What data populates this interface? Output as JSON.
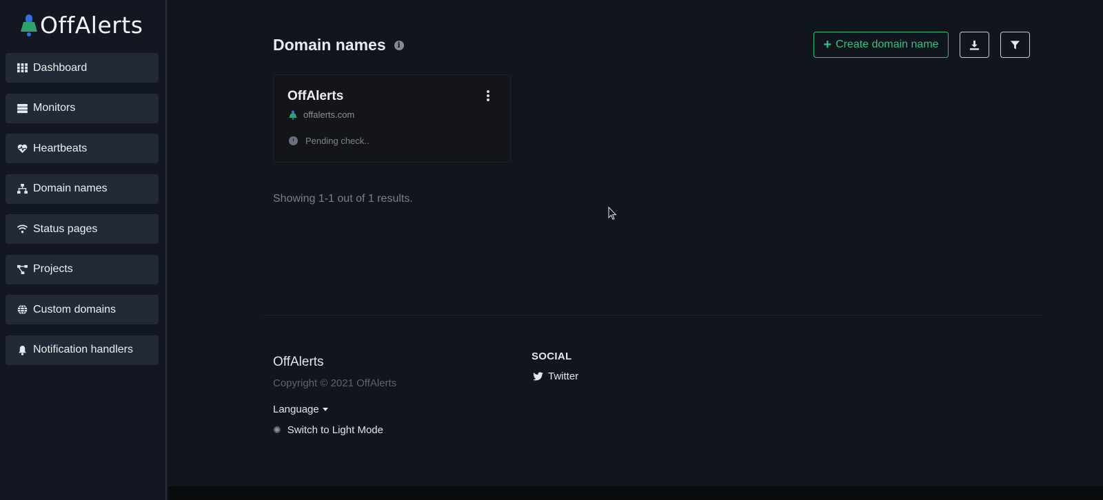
{
  "brand": {
    "name": "OffAlerts"
  },
  "sidebar": {
    "items": [
      {
        "label": "Dashboard",
        "icon": "grid-icon"
      },
      {
        "label": "Monitors",
        "icon": "server-icon"
      },
      {
        "label": "Heartbeats",
        "icon": "heartbeat-icon"
      },
      {
        "label": "Domain names",
        "icon": "sitemap-icon"
      },
      {
        "label": "Status pages",
        "icon": "wifi-icon"
      },
      {
        "label": "Projects",
        "icon": "project-diagram-icon"
      },
      {
        "label": "Custom domains",
        "icon": "globe-icon"
      },
      {
        "label": "Notification handlers",
        "icon": "bell-icon"
      }
    ]
  },
  "header": {
    "title": "Domain names",
    "create_label": "Create domain name"
  },
  "card": {
    "title": "OffAlerts",
    "domain": "offalerts.com",
    "status": "Pending check.."
  },
  "results_text": "Showing 1-1 out of 1 results.",
  "footer": {
    "brand": "OffAlerts",
    "copyright": "Copyright © 2021 OffAlerts",
    "language_label": "Language",
    "light_mode_label": "Switch to Light Mode",
    "social_heading": "SOCIAL",
    "twitter_label": "Twitter"
  },
  "colors": {
    "background": "#11151d",
    "sidebar_item": "#222937",
    "accent_green": "#33c27f"
  }
}
